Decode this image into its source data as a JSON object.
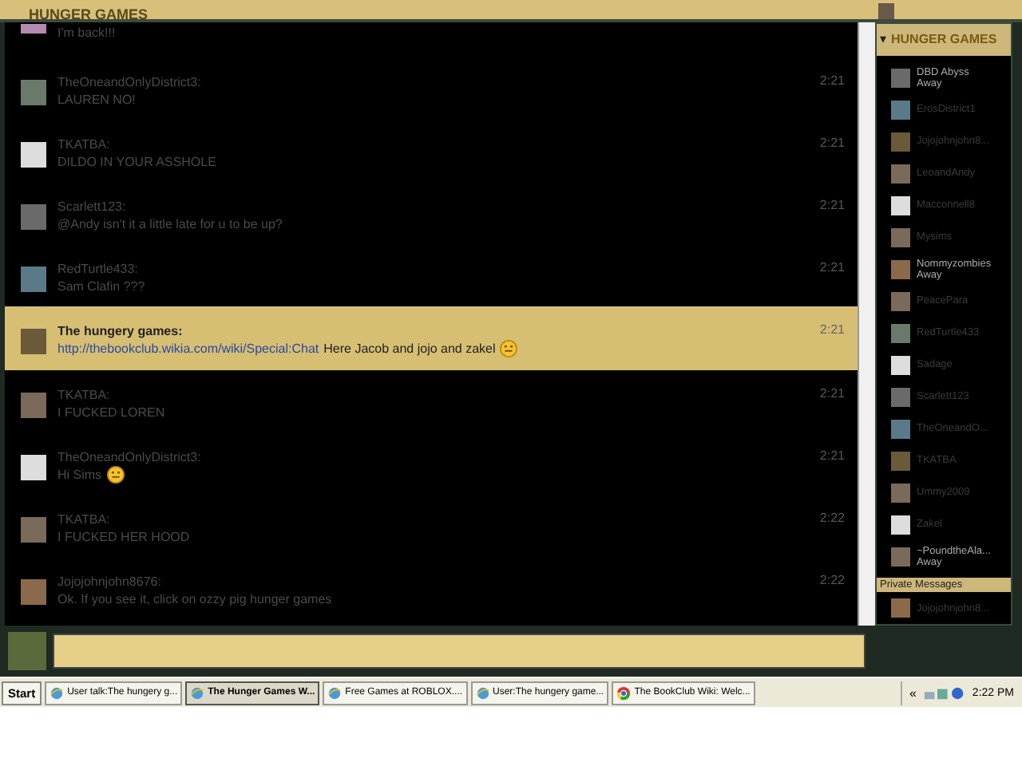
{
  "top_bar": {
    "logo": "HUNGER GAMES"
  },
  "messages": [
    {
      "kind": "partial",
      "text": "I'm back!!!"
    },
    {
      "kind": "message",
      "name": "TheOneandOnlyDistrict3:",
      "text": "LAUREN NO!",
      "time": "2:21",
      "highlighted": false,
      "emoticon": false
    },
    {
      "kind": "message",
      "name": "TKATBA:",
      "text": "DILDO IN YOUR ASSHOLE",
      "time": "2:21",
      "highlighted": false,
      "emoticon": false
    },
    {
      "kind": "message",
      "name": "Scarlett123:",
      "text": "@Andy isn't it a little late for u to be up?",
      "time": "2:21",
      "highlighted": false,
      "emoticon": false
    },
    {
      "kind": "message",
      "name": "RedTurtle433:",
      "text": "Sam Clafin ???",
      "time": "2:21",
      "highlighted": false,
      "emoticon": false
    },
    {
      "kind": "message",
      "name": "The hungery games:",
      "text": "Here Jacob and jojo and zakel",
      "time": "2:21",
      "link": "http://thebookclub.wikia.com/wiki/Special:Chat",
      "highlighted": true,
      "emoticon": true
    },
    {
      "kind": "message",
      "name": "TKATBA:",
      "text": "I FUCKED LOREN",
      "time": "2:21",
      "highlighted": false,
      "emoticon": false
    },
    {
      "kind": "message",
      "name": "TheOneandOnlyDistrict3:",
      "text": "Hi Sims",
      "time": "2:21",
      "highlighted": false,
      "emoticon": true
    },
    {
      "kind": "message",
      "name": "TKATBA:",
      "text": "I FUCKED HER HOOD",
      "time": "2:22",
      "highlighted": false,
      "emoticon": false
    },
    {
      "kind": "message",
      "name": "Jojojohnjohn8676:",
      "text": "Ok. If you see it, click on ozzy pig hunger games",
      "time": "2:22",
      "highlighted": false,
      "emoticon": false
    }
  ],
  "sidebar": {
    "collapse_icon": "▾",
    "logo": "HUNGER GAMES",
    "users": [
      {
        "name": "DBD Abyss",
        "away": true,
        "status": "Away"
      },
      {
        "name": "ErosDistrict1",
        "away": false
      },
      {
        "name": "Jojojohnjohn8...",
        "away": false
      },
      {
        "name": "LeoandAndy",
        "away": false
      },
      {
        "name": "Macconnell8",
        "away": false
      },
      {
        "name": "Mysims",
        "away": false
      },
      {
        "name": "Nommyzombies",
        "away": true,
        "status": "Away"
      },
      {
        "name": "PeacePara",
        "away": false
      },
      {
        "name": "RedTurtle433",
        "away": false
      },
      {
        "name": "Sadage",
        "away": false
      },
      {
        "name": "Scarlett123",
        "away": false
      },
      {
        "name": "TheOneandO...",
        "away": false
      },
      {
        "name": "TKATBA",
        "away": false
      },
      {
        "name": "Ummy2009",
        "away": false
      },
      {
        "name": "Zakel",
        "away": false
      },
      {
        "name": "~PoundtheAla...",
        "away": true,
        "status": "Away"
      }
    ],
    "private_title": "Private Messages",
    "private_users": [
      {
        "name": "Jojojohnjohn8..."
      }
    ]
  },
  "taskbar": {
    "start": "Start",
    "items": [
      {
        "label": "User talk:The hungery g...",
        "selected": false,
        "kind": "ie"
      },
      {
        "label": "The Hunger Games W...",
        "selected": true,
        "kind": "ie"
      },
      {
        "label": "Free Games at ROBLOX....",
        "selected": false,
        "kind": "ie"
      },
      {
        "label": "User:The hungery game...",
        "selected": false,
        "kind": "ie"
      },
      {
        "label": "The BookClub Wiki: Welc...",
        "selected": false,
        "kind": "chrome"
      }
    ],
    "tray_arrows": "«",
    "clock": "2:22 PM"
  }
}
